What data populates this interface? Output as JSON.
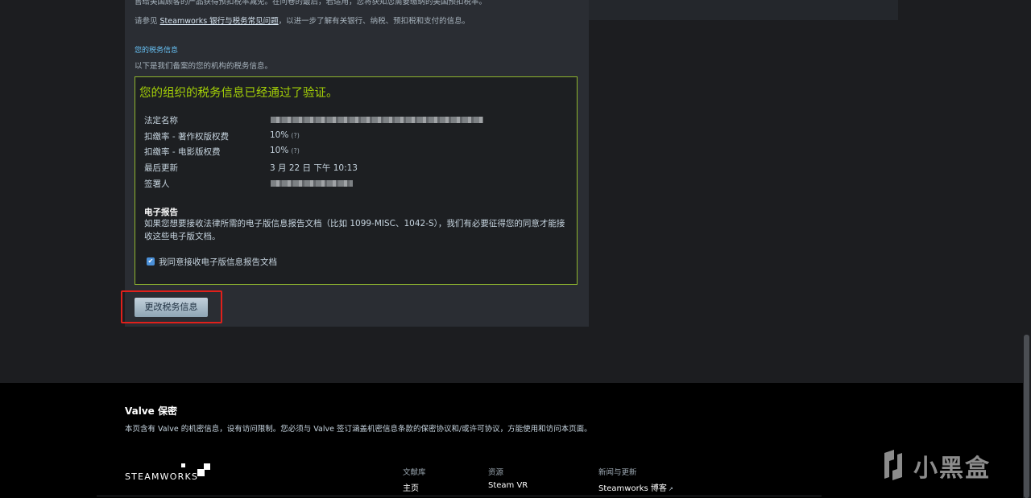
{
  "intro": {
    "line1": "售给美国顾客的产品获得预扣税率减免。在问卷的最后，若适用，您将获知您需要缴纳的美国预扣税率。",
    "line2_prefix": "请参见 ",
    "line2_link": "Steamworks 银行与税务常见问题",
    "line2_suffix": "，以进一步了解有关银行、纳税、预扣税和支付的信息。"
  },
  "tax_section": {
    "heading": "您的税务信息",
    "description": "以下是我们备案的您的机构的税务信息。",
    "verified_title": "您的组织的税务信息已经通过了验证。",
    "rows": [
      {
        "label": "法定名称",
        "value": ""
      },
      {
        "label": "扣缴率 - 著作权版权费",
        "value": "10%",
        "hint": "(?)"
      },
      {
        "label": "扣缴率 - 电影版权费",
        "value": "10%",
        "hint": "(?)"
      },
      {
        "label": "最后更新",
        "value": "3 月 22 日 下午 10:13"
      },
      {
        "label": "签署人",
        "value": ""
      }
    ],
    "ereport_title": "电子报告",
    "ereport_desc": "如果您想要接收法律所需的电子版信息报告文档（比如 1099-MISC、1042-S），我们有必要征得您的同意才能接收这些电子版文档。",
    "consent_label": "我同意接收电子版信息报告文档",
    "consent_checked": true,
    "change_button": "更改税务信息"
  },
  "footer": {
    "title": "Valve 保密",
    "description": "本页含有 Valve 的机密信息，设有访问限制。您必须与 Valve 签订涵盖机密信息条款的保密协议和/或许可协议，方能使用和访问本页面。",
    "logo_text": "STEAMWORKS",
    "columns": [
      {
        "heading": "文献库",
        "link": "主页"
      },
      {
        "heading": "资源",
        "link": "Steam VR"
      },
      {
        "heading": "新闻与更新",
        "link": "Steamworks 博客"
      }
    ]
  },
  "watermark": {
    "text": "小黑盒",
    "icon": "heybox-logo-icon"
  },
  "colors": {
    "verified": "#a4d007",
    "link": "#67c1f5",
    "highlight": "#e0201b"
  }
}
